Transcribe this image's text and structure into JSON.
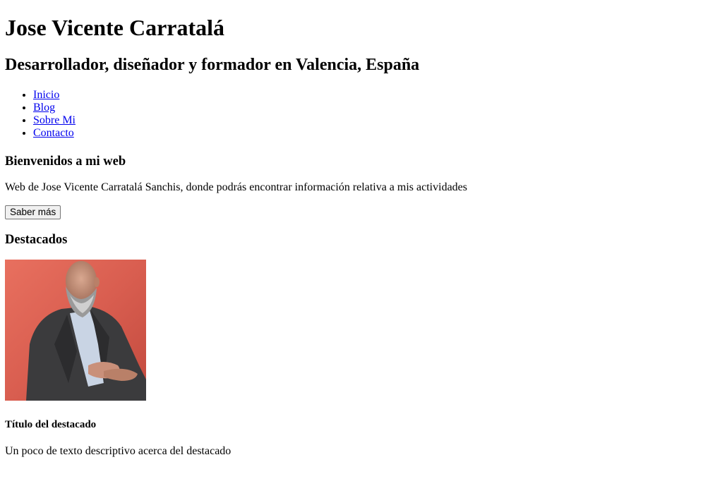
{
  "header": {
    "title": "Jose Vicente Carratalá",
    "subtitle": "Desarrollador, diseñador y formador en Valencia, España"
  },
  "nav": {
    "items": [
      {
        "label": "Inicio"
      },
      {
        "label": "Blog"
      },
      {
        "label": "Sobre Mi"
      },
      {
        "label": "Contacto"
      }
    ]
  },
  "welcome": {
    "heading": "Bienvenidos a mi web",
    "text": "Web de Jose Vicente Carratalá Sanchis, donde podrás encontrar información relativa a mis actividades",
    "button_label": "Saber más"
  },
  "featured": {
    "heading": "Destacados",
    "item": {
      "title": "Título del destacado",
      "description": "Un poco de texto descriptivo acerca del destacado"
    }
  }
}
